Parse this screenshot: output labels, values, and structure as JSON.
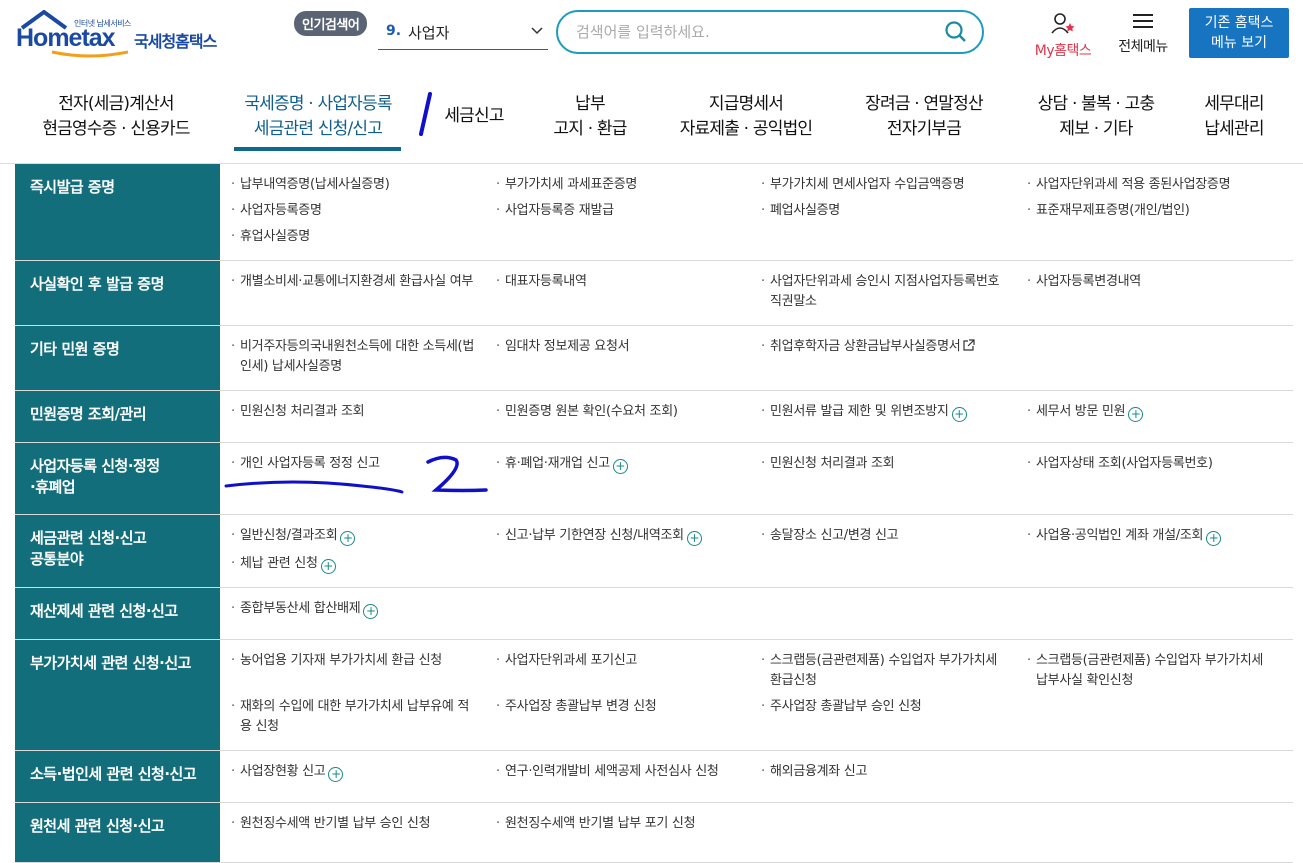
{
  "header": {
    "logo_small": "인터넷 납세서비스",
    "logo_brand": "Hometax",
    "logo_name": "국세청홈택스",
    "popular_label": "인기검색어",
    "popular_rank": "9.",
    "popular_keyword": "사업자",
    "search_placeholder": "검색어를 입력하세요.",
    "my_hometax": "My홈택스",
    "all_menu": "전체메뉴",
    "old_hometax_line1": "기존 홈택스",
    "old_hometax_line2": "메뉴 보기"
  },
  "nav": [
    {
      "line1": "전자(세금)계산서",
      "line2": "현금영수증 · 신용카드"
    },
    {
      "line1": "국세증명 · 사업자등록",
      "line2": "세금관련 신청/신고",
      "active": true
    },
    {
      "line1": "세금신고",
      "line2": ""
    },
    {
      "line1": "납부",
      "line2": "고지 · 환급"
    },
    {
      "line1": "지급명세서",
      "line2": "자료제출 · 공익법인"
    },
    {
      "line1": "장려금 · 연말정산",
      "line2": "전자기부금"
    },
    {
      "line1": "상담 · 불복 · 고충",
      "line2": "제보 · 기타"
    },
    {
      "line1": "세무대리",
      "line2": "납세관리"
    }
  ],
  "annotations": {
    "mark1": "1",
    "mark2": "2"
  },
  "sections": [
    {
      "category": "즉시발급 증명",
      "links": [
        {
          "text": "납부내역증명(납세사실증명)"
        },
        {
          "text": "부가가치세 과세표준증명"
        },
        {
          "text": "부가가치세 면세사업자 수입금액증명"
        },
        {
          "text": "사업자단위과세 적용 종된사업장증명"
        },
        {
          "text": "사업자등록증명"
        },
        {
          "text": "사업자등록증 재발급"
        },
        {
          "text": "폐업사실증명"
        },
        {
          "text": "표준재무제표증명(개인/법인)"
        },
        {
          "text": "휴업사실증명"
        }
      ]
    },
    {
      "category": "사실확인 후 발급 증명",
      "links": [
        {
          "text": "개별소비세·교통에너지환경세 환급사실 여부"
        },
        {
          "text": "대표자등록내역"
        },
        {
          "text": "사업자단위과세 승인시 지점사업자등록번호 직권말소"
        },
        {
          "text": "사업자등록변경내역"
        }
      ]
    },
    {
      "category": "기타 민원 증명",
      "links": [
        {
          "text": "비거주자등의국내원천소득에 대한 소득세(법인세) 납세사실증명"
        },
        {
          "text": "임대차 정보제공 요청서"
        },
        {
          "text": "취업후학자금 상환금납부사실증명서",
          "ext": true
        }
      ]
    },
    {
      "category": "민원증명 조회/관리",
      "links": [
        {
          "text": "민원신청 처리결과 조회"
        },
        {
          "text": "민원증명 원본 확인(수요처 조회)"
        },
        {
          "text": "민원서류 발급 제한 및 위변조방지",
          "plus": true
        },
        {
          "text": "세무서 방문 민원",
          "plus": true
        }
      ]
    },
    {
      "category": "사업자등록 신청·정정·휴폐업",
      "links": [
        {
          "text": "개인 사업자등록 정정 신고"
        },
        {
          "text": "휴·폐업·재개업 신고",
          "plus": true
        },
        {
          "text": "민원신청 처리결과 조회"
        },
        {
          "text": "사업자상태 조회(사업자등록번호)"
        }
      ]
    },
    {
      "category": "세금관련 신청·신고 공통분야",
      "links": [
        {
          "text": "일반신청/결과조회",
          "plus": true
        },
        {
          "text": "신고·납부 기한연장 신청/내역조회",
          "plus": true
        },
        {
          "text": "송달장소 신고/변경 신고"
        },
        {
          "text": "사업용·공익법인 계좌 개설/조회",
          "plus": true
        },
        {
          "text": "체납 관련 신청",
          "plus": true
        }
      ]
    },
    {
      "category": "재산제세 관련 신청·신고",
      "links": [
        {
          "text": "종합부동산세 합산배제",
          "plus": true
        }
      ]
    },
    {
      "category": "부가가치세 관련 신청·신고",
      "links": [
        {
          "text": "농어업용 기자재 부가가치세 환급 신청"
        },
        {
          "text": "사업자단위과세 포기신고"
        },
        {
          "text": "스크랩등(금관련제품) 수입업자 부가가치세 환급신청"
        },
        {
          "text": "스크랩등(금관련제품) 수입업자 부가가치세 납부사실 확인신청"
        },
        {
          "text": "재화의 수입에 대한 부가가치세 납부유예 적용 신청"
        },
        {
          "text": "주사업장 총괄납부 변경 신청"
        },
        {
          "text": "주사업장 총괄납부 승인 신청"
        }
      ]
    },
    {
      "category": "소득·법인세 관련 신청·신고",
      "links": [
        {
          "text": "사업장현황 신고",
          "plus": true
        },
        {
          "text": "연구·인력개발비 세액공제 사전심사 신청"
        },
        {
          "text": "해외금융계좌 신고"
        }
      ]
    },
    {
      "category": "원천세 관련 신청·신고",
      "links": [
        {
          "text": "원천징수세액 반기별 납부 승인 신청"
        },
        {
          "text": "원천징수세액 반기별 납부 포기 신청"
        }
      ]
    }
  ]
}
